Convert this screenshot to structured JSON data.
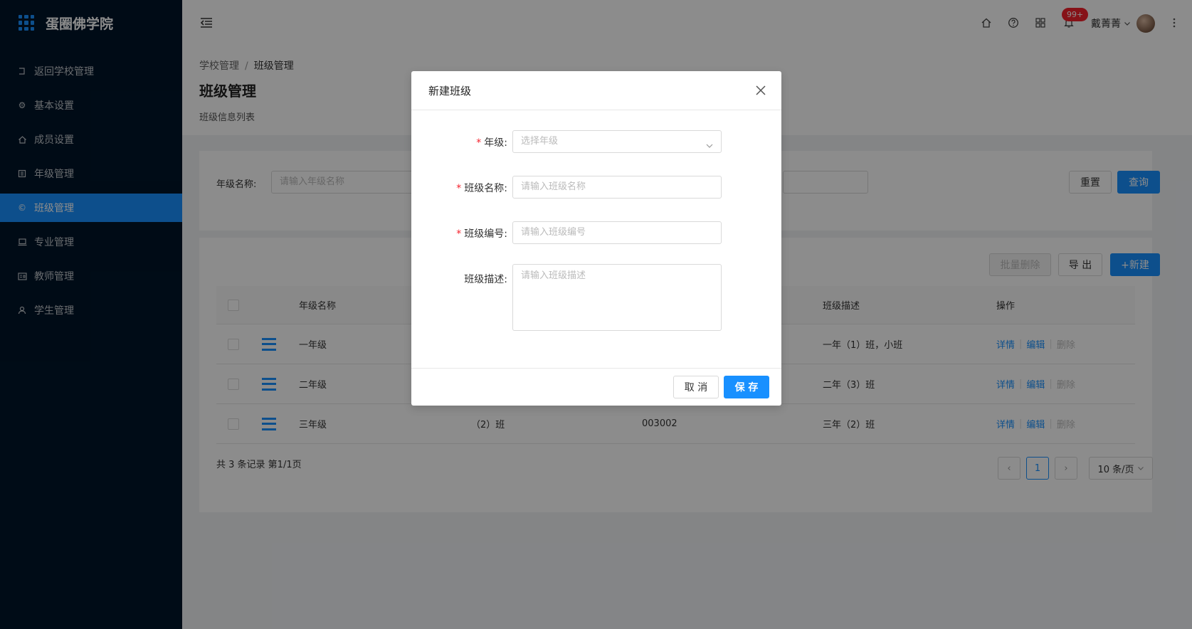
{
  "app": {
    "title": "蛋圈佛学院"
  },
  "sidebar": {
    "items": [
      {
        "label": "返回学校管理",
        "icon": "return-icon"
      },
      {
        "label": "基本设置",
        "icon": "gear-icon"
      },
      {
        "label": "成员设置",
        "icon": "home-icon"
      },
      {
        "label": "年级管理",
        "icon": "building-icon"
      },
      {
        "label": "班级管理",
        "icon": "copyright-icon",
        "active": true
      },
      {
        "label": "专业管理",
        "icon": "laptop-icon"
      },
      {
        "label": "教师管理",
        "icon": "id-card-icon"
      },
      {
        "label": "学生管理",
        "icon": "user-icon"
      }
    ]
  },
  "header": {
    "notification_count": "99+",
    "user_name": "戴菁菁"
  },
  "breadcrumb": {
    "parent": "学校管理",
    "separator": "/",
    "current": "班级管理"
  },
  "page": {
    "title": "班级管理",
    "subtitle": "班级信息列表"
  },
  "search": {
    "label": "年级名称:",
    "placeholder": "请输入年级名称",
    "reset_label": "重置",
    "query_label": "查询"
  },
  "toolbar": {
    "batch_delete": "批量删除",
    "export": "导 出",
    "new": "+新建"
  },
  "table": {
    "columns": [
      "年级名称",
      "",
      "",
      "班级描述",
      "操作"
    ],
    "rows": [
      {
        "grade": "一年级",
        "class_name": "",
        "code": "",
        "desc": "一年（1）班，小班"
      },
      {
        "grade": "二年级",
        "class_name": "",
        "code": "",
        "desc": "二年（3）班"
      },
      {
        "grade": "三年级",
        "class_name": "（2）班",
        "code": "003002",
        "desc": "三年（2）班"
      }
    ],
    "actions": {
      "detail": "详情",
      "edit": "编辑",
      "delete": "删除"
    }
  },
  "pagination": {
    "summary": "共 3 条记录 第1/1页",
    "current_page": "1",
    "page_size": "10 条/页"
  },
  "modal": {
    "title": "新建班级",
    "fields": [
      {
        "label": "年级:",
        "required": true,
        "placeholder": "选择年级",
        "type": "select"
      },
      {
        "label": "班级名称:",
        "required": true,
        "placeholder": "请输入班级名称",
        "type": "input"
      },
      {
        "label": "班级编号:",
        "required": true,
        "placeholder": "请输入班级编号",
        "type": "input"
      },
      {
        "label": "班级描述:",
        "required": false,
        "placeholder": "请输入班级描述",
        "type": "textarea"
      }
    ],
    "cancel_label": "取 消",
    "save_label": "保 存"
  },
  "colors": {
    "primary": "#1890ff",
    "sidebar_bg": "#001529",
    "required": "#f5222d"
  }
}
